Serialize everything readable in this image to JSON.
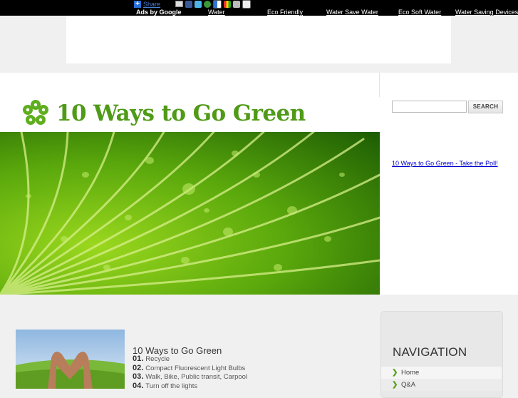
{
  "share": {
    "label": "Share"
  },
  "ads": {
    "label": "Ads by Google",
    "links": [
      "Water",
      "Eco Friendly",
      "Water Save Water",
      "Eco Soft Water",
      "Water Saving Devices"
    ]
  },
  "site": {
    "title": "10 Ways to Go Green"
  },
  "search": {
    "placeholder": "",
    "button": "SEARCH"
  },
  "sidebar": {
    "poll_link": "10 Ways to Go Green - Take the Poll!"
  },
  "post": {
    "title": "10 Ways to Go Green",
    "items": [
      {
        "num": "01.",
        "text": "Recycle"
      },
      {
        "num": "02.",
        "text": "Compact Fluorescent Light Bulbs"
      },
      {
        "num": "03.",
        "text": "Walk, Bike, Public transit, Carpool"
      },
      {
        "num": "04.",
        "text": "Turn off the lights"
      }
    ]
  },
  "navigation": {
    "title": "NAVIGATION",
    "items": [
      "Home",
      "Q&A"
    ]
  },
  "colors": {
    "brand_green": "#4f9a17",
    "top_bar": "#000000",
    "link_blue": "#0000cc"
  },
  "icons": [
    "plus-share-icon",
    "email-icon",
    "facebook-icon",
    "twitter-icon",
    "stumbleupon-icon",
    "delicious-icon",
    "google-icon",
    "myspace-icon",
    "print-icon",
    "clover-logo-icon"
  ]
}
